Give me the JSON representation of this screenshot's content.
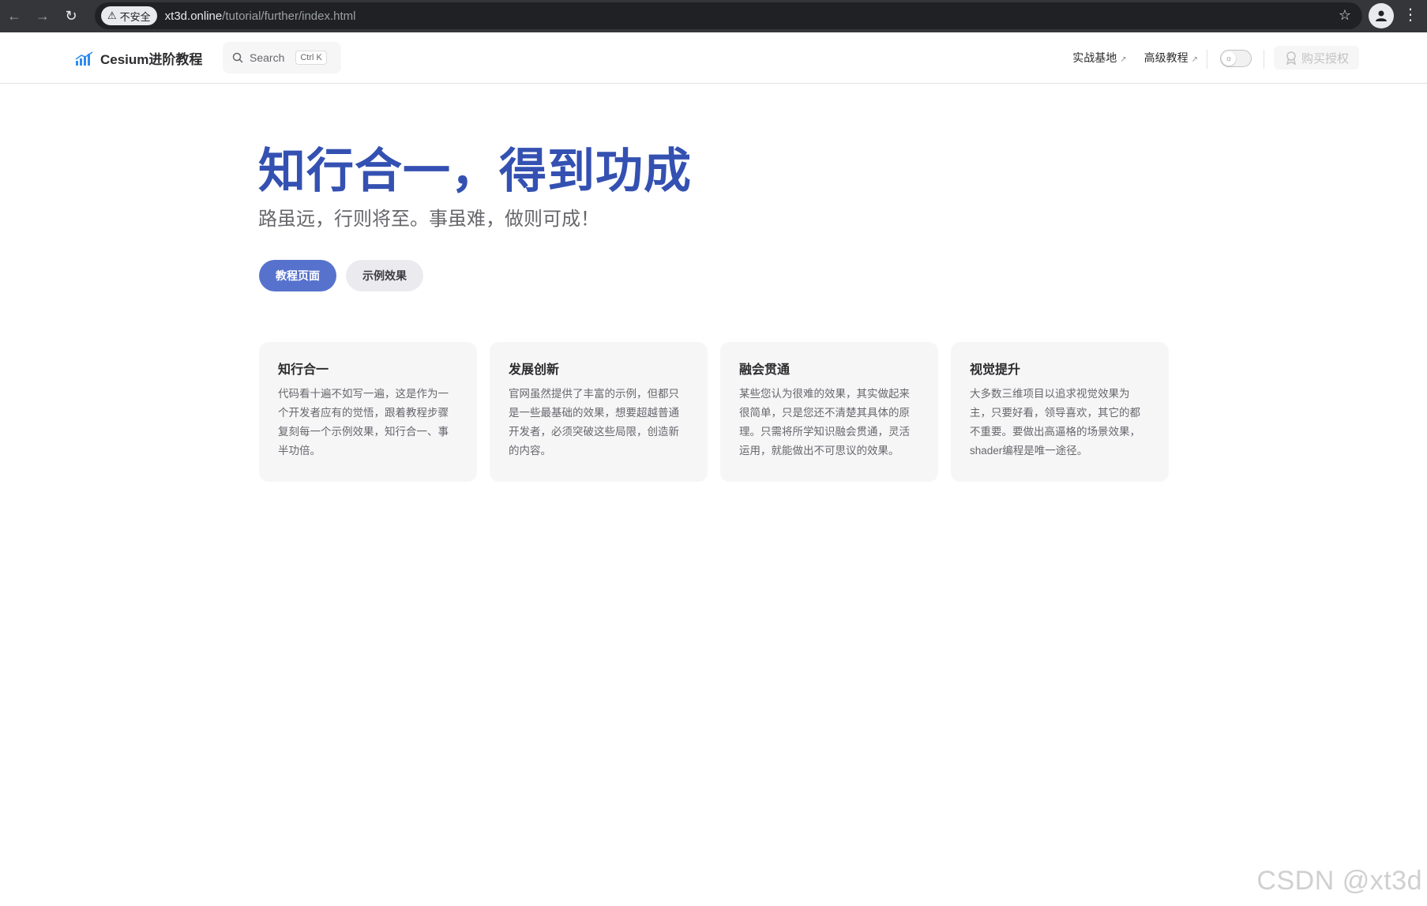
{
  "browser": {
    "security_label": "不安全",
    "url_host": "xt3d.online",
    "url_path": "/tutorial/further/index.html"
  },
  "nav": {
    "brand_title": "Cesium进阶教程",
    "search_label": "Search",
    "search_kbd": "Ctrl K",
    "links": [
      {
        "label": "实战基地",
        "external": "↗"
      },
      {
        "label": "高级教程",
        "external": "↗"
      }
    ],
    "buy_label": "购买授权"
  },
  "hero": {
    "title": "知行合一，得到功成",
    "tagline": "路虽远，行则将至。事虽难，做则可成！",
    "actions": [
      {
        "label": "教程页面",
        "theme": "brand"
      },
      {
        "label": "示例效果",
        "theme": "alt"
      }
    ]
  },
  "features": [
    {
      "title": "知行合一",
      "details": "代码看十遍不如写一遍，这是作为一个开发者应有的觉悟，跟着教程步骤复刻每一个示例效果，知行合一、事半功倍。"
    },
    {
      "title": "发展创新",
      "details": "官网虽然提供了丰富的示例，但都只是一些最基础的效果，想要超越普通开发者，必须突破这些局限，创造新的内容。"
    },
    {
      "title": "融会贯通",
      "details": "某些您认为很难的效果，其实做起来很简单，只是您还不清楚其具体的原理。只需将所学知识融会贯通，灵活运用，就能做出不可思议的效果。"
    },
    {
      "title": "视觉提升",
      "details": "大多数三维项目以追求视觉效果为主，只要好看，领导喜欢，其它的都不重要。要做出高逼格的场景效果，shader编程是唯一途径。"
    }
  ],
  "watermark": "CSDN @xt3d",
  "colors": {
    "brand": "#3451b2",
    "button_primary": "#5672cd",
    "card_bg": "#f6f6f7"
  }
}
